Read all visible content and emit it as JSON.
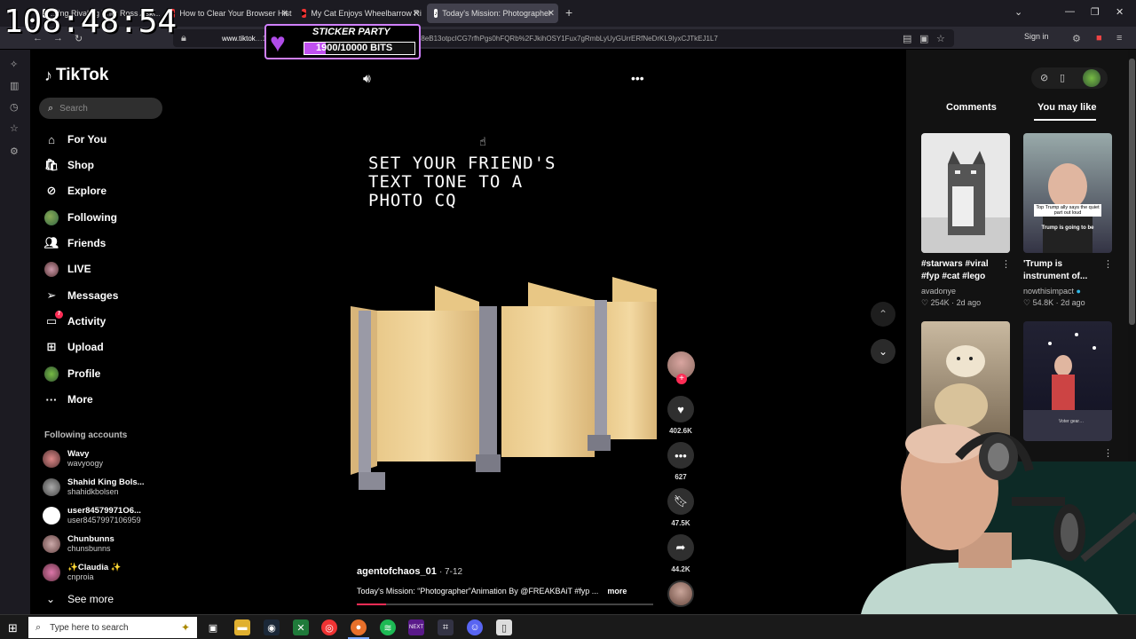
{
  "overlay": {
    "clock": "108:48:54",
    "sticker_title": "STICKER PARTY",
    "bits": "1900/10000 BITS",
    "bits_fraction": 0.19
  },
  "browser": {
    "tabs": [
      {
        "label": "…ing Rivaling With Ross Ask…",
        "active": false
      },
      {
        "label": "How to Clear Your Browser Hist",
        "active": false
      },
      {
        "label": "My Cat Enjoys Wheelbarrow Ri",
        "active": false
      },
      {
        "label": "Today's Mission: Photographer",
        "active": true
      }
    ],
    "url_host": "www.tiktok",
    "url_rest": "…103060606263?_d=secCgYIASAHKAESPgo8mcu8eB13otpcICG7rfhPgs0hFQRb%2FJkihOSY1Fux7gRmbLyUyGUrrERfNeDrKL9IyxCJTkEJ1L7",
    "signin": "Sign in"
  },
  "sidebar": {
    "brand": "TikTok",
    "search_placeholder": "Search",
    "nav": [
      {
        "label": "For You",
        "icon": "home-icon"
      },
      {
        "label": "Shop",
        "icon": "shop-icon"
      },
      {
        "label": "Explore",
        "icon": "compass-icon"
      },
      {
        "label": "Following",
        "icon": "avatar-icon"
      },
      {
        "label": "Friends",
        "icon": "friends-icon"
      },
      {
        "label": "LIVE",
        "icon": "live-icon"
      },
      {
        "label": "Messages",
        "icon": "paper-plane-icon"
      },
      {
        "label": "Activity",
        "icon": "inbox-icon",
        "badge": "7"
      },
      {
        "label": "Upload",
        "icon": "plus-square-icon"
      },
      {
        "label": "Profile",
        "icon": "profile-avatar-icon"
      },
      {
        "label": "More",
        "icon": "dots-icon"
      }
    ],
    "following_title": "Following accounts",
    "accounts": [
      {
        "name": "Wavy",
        "handle": "wavyoogy"
      },
      {
        "name": "Shahid King Bols...",
        "handle": "shahidkbolsen"
      },
      {
        "name": "user84579971O6...",
        "handle": "user8457997106959"
      },
      {
        "name": "Chunbunns",
        "handle": "chunsbunns"
      },
      {
        "name": "✨Claudia ✨",
        "handle": "cnproia"
      }
    ],
    "see_more": "See more"
  },
  "video": {
    "overlay_text": "SET YOUR FRIEND'S\nTEXT TONE TO A\nPHOTO CQ",
    "author": "agentofchaos_01",
    "date": "· 7-12",
    "caption": "Today's Mission: “Photographer”Animation By @FREAKBAiT #fyp ...",
    "caption_more": "more",
    "progress_fraction": 0.1,
    "likes": "402.6K",
    "comments": "627",
    "saves": "47.5K",
    "shares": "44.2K"
  },
  "right_panel": {
    "tabs": [
      "Comments",
      "You may like"
    ],
    "active_tab": "You may like",
    "cards": [
      {
        "title": "#starwars #viral #fyp #cat #lego",
        "user": "avadonye",
        "likes": "254K",
        "age": "2d ago"
      },
      {
        "title": "'Trump is instrument of...",
        "user": "nowthisimpact",
        "likes": "54.8K",
        "age": "2d ago",
        "thumb_lines": [
          "Top Trump ally says the quiet part out loud",
          "Trump is going to be"
        ]
      },
      {
        "title": "",
        "user": "",
        "likes": "",
        "age": ""
      },
      {
        "title": "",
        "user": "",
        "likes": "",
        "age": "",
        "thumb_caption": "Voter gear…"
      }
    ]
  },
  "taskbar": {
    "search_placeholder": "Type here to search",
    "next_label": "NEXT"
  }
}
